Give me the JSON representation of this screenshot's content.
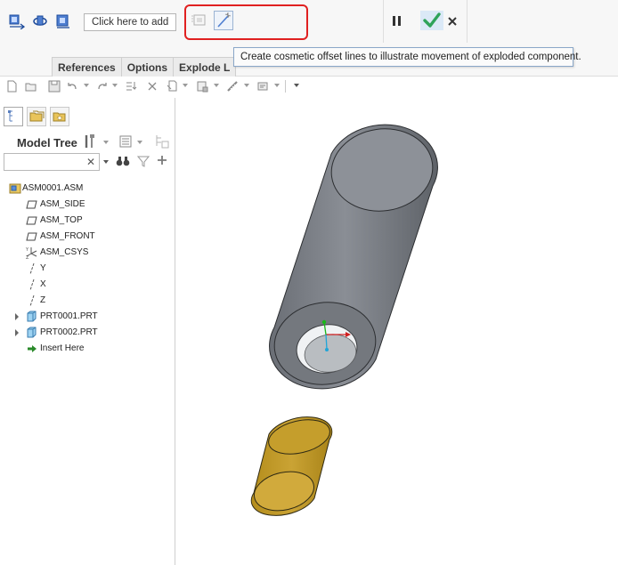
{
  "dashboard": {
    "collector_placeholder": "Click here to add",
    "tabs": [
      {
        "label": "References"
      },
      {
        "label": "Options"
      },
      {
        "label": "Explode L"
      }
    ],
    "tooltip": "Create cosmetic offset lines to illustrate movement of exploded component."
  },
  "model_tree": {
    "title": "Model Tree",
    "items": [
      {
        "label": "ASM0001.ASM",
        "icon": "assembly-icon"
      },
      {
        "label": "ASM_SIDE",
        "icon": "datum-plane-icon"
      },
      {
        "label": "ASM_TOP",
        "icon": "datum-plane-icon"
      },
      {
        "label": "ASM_FRONT",
        "icon": "datum-plane-icon"
      },
      {
        "label": "ASM_CSYS",
        "icon": "csys-icon"
      },
      {
        "label": "Y",
        "icon": "axis-icon"
      },
      {
        "label": "X",
        "icon": "axis-icon"
      },
      {
        "label": "Z",
        "icon": "axis-icon"
      },
      {
        "label": "PRT0001.PRT",
        "icon": "part-icon"
      },
      {
        "label": "PRT0002.PRT",
        "icon": "part-icon"
      },
      {
        "label": "Insert Here",
        "icon": "insert-arrow-icon"
      }
    ]
  },
  "colors": {
    "highlight_box": "#e02020",
    "accept_check": "#2fa35a",
    "cylinder_gray": "#7a7e85",
    "part_gold": "#c8a12a"
  }
}
